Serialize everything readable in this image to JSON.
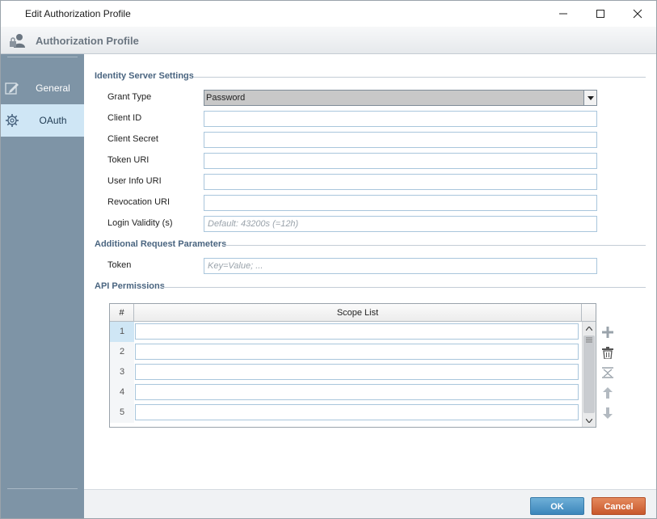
{
  "window": {
    "title": "Edit Authorization Profile"
  },
  "header": {
    "title": "Authorization Profile"
  },
  "sidebar": {
    "items": [
      {
        "label": "General",
        "icon": "edit-icon",
        "selected": false
      },
      {
        "label": "OAuth",
        "icon": "gear-icon",
        "selected": true
      }
    ]
  },
  "identity": {
    "section_title": "Identity Server Settings",
    "grant_type": {
      "label": "Grant Type",
      "value": "Password"
    },
    "client_id": {
      "label": "Client ID",
      "value": ""
    },
    "client_secret": {
      "label": "Client Secret",
      "value": ""
    },
    "token_uri": {
      "label": "Token URI",
      "value": ""
    },
    "user_info_uri": {
      "label": "User Info URI",
      "value": ""
    },
    "revocation_uri": {
      "label": "Revocation URI",
      "value": ""
    },
    "login_validity": {
      "label": "Login Validity (s)",
      "value": "",
      "placeholder": "Default: 43200s (=12h)"
    }
  },
  "additional": {
    "section_title": "Additional Request Parameters",
    "token": {
      "label": "Token",
      "value": "",
      "placeholder": "Key=Value; ..."
    }
  },
  "permissions": {
    "section_title": "API Permissions",
    "columns": [
      "#",
      "Scope List"
    ],
    "rows": [
      {
        "num": "1",
        "value": ""
      },
      {
        "num": "2",
        "value": ""
      },
      {
        "num": "3",
        "value": ""
      },
      {
        "num": "4",
        "value": ""
      },
      {
        "num": "5",
        "value": ""
      }
    ],
    "tools": [
      "add-icon",
      "delete-icon",
      "clear-icon",
      "move-up-icon",
      "move-down-icon"
    ]
  },
  "footer": {
    "ok_label": "OK",
    "cancel_label": "Cancel"
  },
  "colors": {
    "sidebar": "#7e94a6",
    "selected_item": "#cfe6f5",
    "ok": "#3c86bb",
    "cancel": "#c8582c",
    "section_title": "#4a6580"
  }
}
